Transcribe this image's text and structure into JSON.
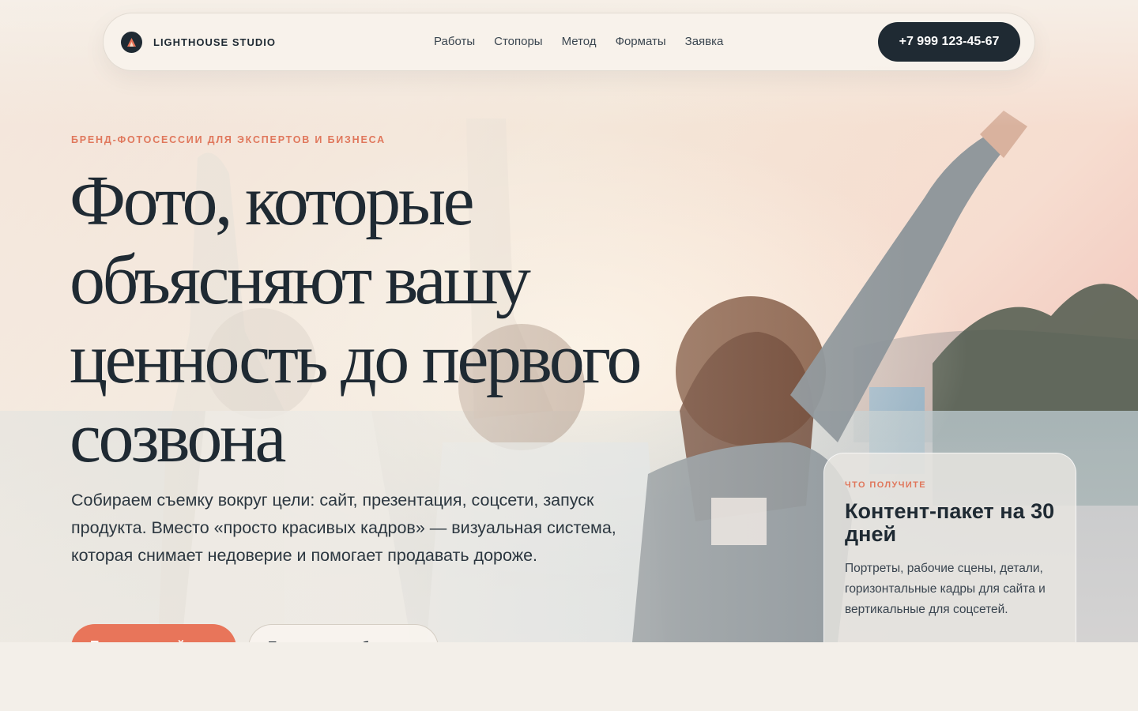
{
  "nav": {
    "brand": "LIGHTHOUSE STUDIO",
    "logo_icon": "lighthouse-logo-icon",
    "menu": [
      {
        "label": "Работы"
      },
      {
        "label": "Стопоры"
      },
      {
        "label": "Метод"
      },
      {
        "label": "Форматы"
      },
      {
        "label": "Заявка"
      }
    ],
    "phone": "+7 999 123-45-67"
  },
  "hero": {
    "eyebrow": "БРЕНД-ФОТОСЕССИИ ДЛЯ ЭКСПЕРТОВ И БИЗНЕСА",
    "headline_lines": [
      "Фото, которые",
      "объясняют вашу",
      "ценность до первого",
      "созвона"
    ],
    "lead": "Собираем съемку вокруг цели: сайт, презентация, соцсети, запуск продукта. Вместо «просто красивых кадров» — визуальная система, которая снимает недоверие и помогает продавать дороже.",
    "primary_button": "Получить идей",
    "secondary_button": "Посмотреть работы"
  },
  "card": {
    "eyebrow": "ЧТО ПОЛУЧИТЕ",
    "title": "Контент-пакет на 30 дней",
    "text": "Портреты, рабочие сцены, детали, горизонтальные кадры для сайта и вертикальные для соцсетей."
  },
  "colors": {
    "accent": "#e8755a",
    "dark": "#1f2a33",
    "background": "#f3efe9"
  }
}
